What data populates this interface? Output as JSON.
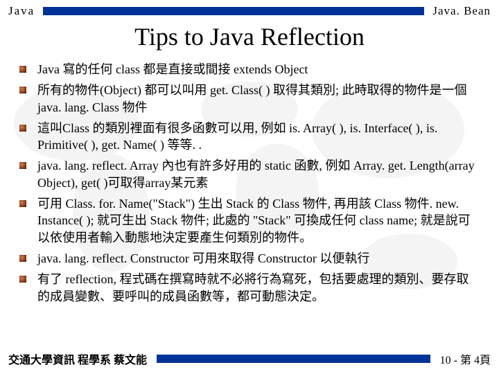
{
  "header": {
    "left": "Java",
    "right": "Java. Bean"
  },
  "title": "Tips to Java Reflection",
  "bullets": [
    "Java 寫的任何 class 都是直接或間接 extends Object",
    "所有的物件(Object) 都可以叫用 get. Class( ) 取得其類別; 此時取得的物件是一個 java. lang. Class 物件",
    "這叫Class 的類別裡面有很多函數可以用, 例如 is. Array( ), is. Interface( ), is. Primitive( ), get. Name( ) 等等. .",
    "java. lang. reflect. Array 內也有許多好用的 static 函數, 例如 Array. get. Length(array Object),  get( )可取得array某元素",
    "可用 Class. for. Name(\"Stack\") 生出 Stack 的 Class 物件, 再用該 Class 物件. new. Instance( ); 就可生出 Stack 物件; 此處的 \"Stack\" 可換成任何 class name; 就是說可以依使用者輸入動態地決定要產生何類別的物件。",
    "java. lang. reflect. Constructor 可用來取得 Constructor 以便執行",
    "有了 reflection, 程式碼在撰寫時就不必將行為寫死，包括要處理的類別、要存取的成員變數、要呼叫的成員函數等，都可動態決定。"
  ],
  "footer": {
    "left": "交通大學資訊 程學系  蔡文能",
    "right": "10 - 第 4頁"
  }
}
